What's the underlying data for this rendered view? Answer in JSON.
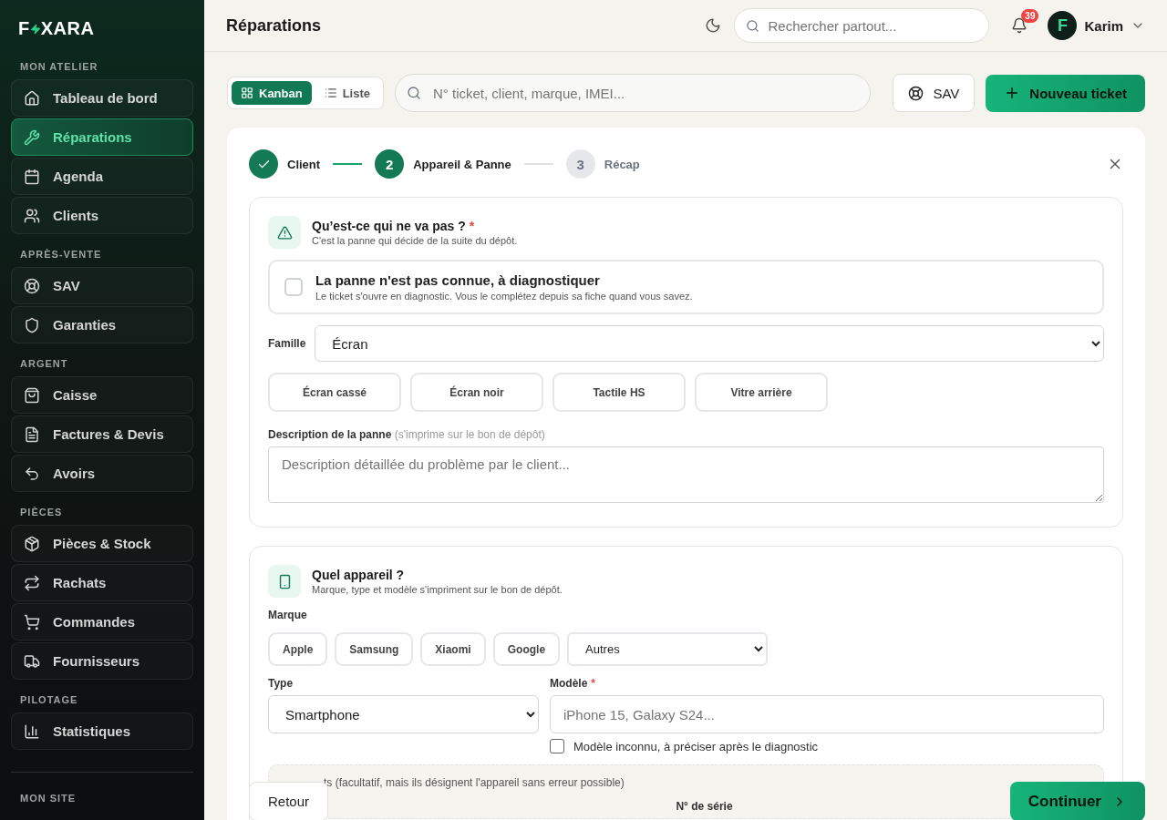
{
  "brand": {
    "lead": "F",
    "tail": "XARA"
  },
  "sidebar": {
    "sections": [
      {
        "title": "MON ATELIER",
        "items": [
          {
            "label": "Tableau de bord",
            "selected": false
          },
          {
            "label": "Réparations",
            "selected": true
          },
          {
            "label": "Agenda",
            "selected": false
          },
          {
            "label": "Clients",
            "selected": false
          }
        ]
      },
      {
        "title": "APRÈS-VENTE",
        "items": [
          {
            "label": "SAV",
            "selected": false
          },
          {
            "label": "Garanties",
            "selected": false
          }
        ]
      },
      {
        "title": "ARGENT",
        "items": [
          {
            "label": "Caisse",
            "selected": false
          },
          {
            "label": "Factures & Devis",
            "selected": false
          },
          {
            "label": "Avoirs",
            "selected": false
          }
        ]
      },
      {
        "title": "PIÈCES",
        "items": [
          {
            "label": "Pièces & Stock",
            "selected": false
          },
          {
            "label": "Rachats",
            "selected": false
          },
          {
            "label": "Commandes",
            "selected": false
          },
          {
            "label": "Fournisseurs",
            "selected": false
          }
        ]
      },
      {
        "title": "PILOTAGE",
        "items": [
          {
            "label": "Statistiques",
            "selected": false
          }
        ]
      },
      {
        "title": "MON SITE"
      }
    ]
  },
  "header": {
    "title": "Réparations",
    "search_placeholder": "Rechercher partout...",
    "notifications": "39",
    "user": {
      "initial": "F",
      "name": "Karim"
    }
  },
  "toolbar": {
    "views": [
      {
        "label": "Kanban",
        "selected": true
      },
      {
        "label": "Liste",
        "selected": false
      }
    ],
    "search_placeholder": "N° ticket, client, marque, IMEI...",
    "sav_button": "SAV",
    "new_button": "Nouveau ticket"
  },
  "stepper": {
    "steps": [
      {
        "label": "Client",
        "kind": "done"
      },
      {
        "number": "2",
        "label": "Appareil & Panne",
        "kind": "current"
      },
      {
        "number": "3",
        "label": "Récap",
        "kind": "todo"
      }
    ]
  },
  "panne": {
    "title": "Qu’est-ce qui ne va pas ?",
    "required_mark": "*",
    "subtitle": "C'est la panne qui décide de la suite du dépôt.",
    "unknown": {
      "label": "La panne n'est pas connue, à diagnostiquer",
      "hint": "Le ticket s'ouvre en diagnostic. Vous le complétez depuis sa fiche quand vous savez.",
      "checked": false
    },
    "famille": {
      "label": "Famille",
      "value": "Écran"
    },
    "quick": [
      {
        "label": "Écran cassé",
        "selected": false
      },
      {
        "label": "Écran noir",
        "selected": false
      },
      {
        "label": "Tactile HS",
        "selected": false
      },
      {
        "label": "Vitre arrière",
        "selected": false
      }
    ],
    "description": {
      "label": "Description de la panne",
      "hint": "(s'imprime sur le bon de dépôt)",
      "placeholder": "Description détaillée du problème par le client..."
    }
  },
  "appareil": {
    "title": "Quel appareil ?",
    "subtitle": "Marque, type et modèle s'impriment sur le bon de dépôt.",
    "marque_label": "Marque",
    "brands": [
      {
        "label": "Apple",
        "selected": false
      },
      {
        "label": "Samsung",
        "selected": false
      },
      {
        "label": "Xiaomi",
        "selected": false
      },
      {
        "label": "Google",
        "selected": false
      }
    ],
    "other_brand": "Autres",
    "type": {
      "label": "Type",
      "value": "Smartphone"
    },
    "modele": {
      "label": "Modèle",
      "required_mark": "*",
      "placeholder": "iPhone 15, Galaxy S24..."
    },
    "unknown_model": {
      "label": "Modèle inconnu, à préciser après le diagnostic",
      "checked": false
    },
    "identifiers": {
      "text": "ts (facultatif, mais ils désignent l'appareil sans erreur possible)",
      "column": "N° de série"
    }
  },
  "footer": {
    "back": "Retour",
    "next": "Continuer"
  }
}
